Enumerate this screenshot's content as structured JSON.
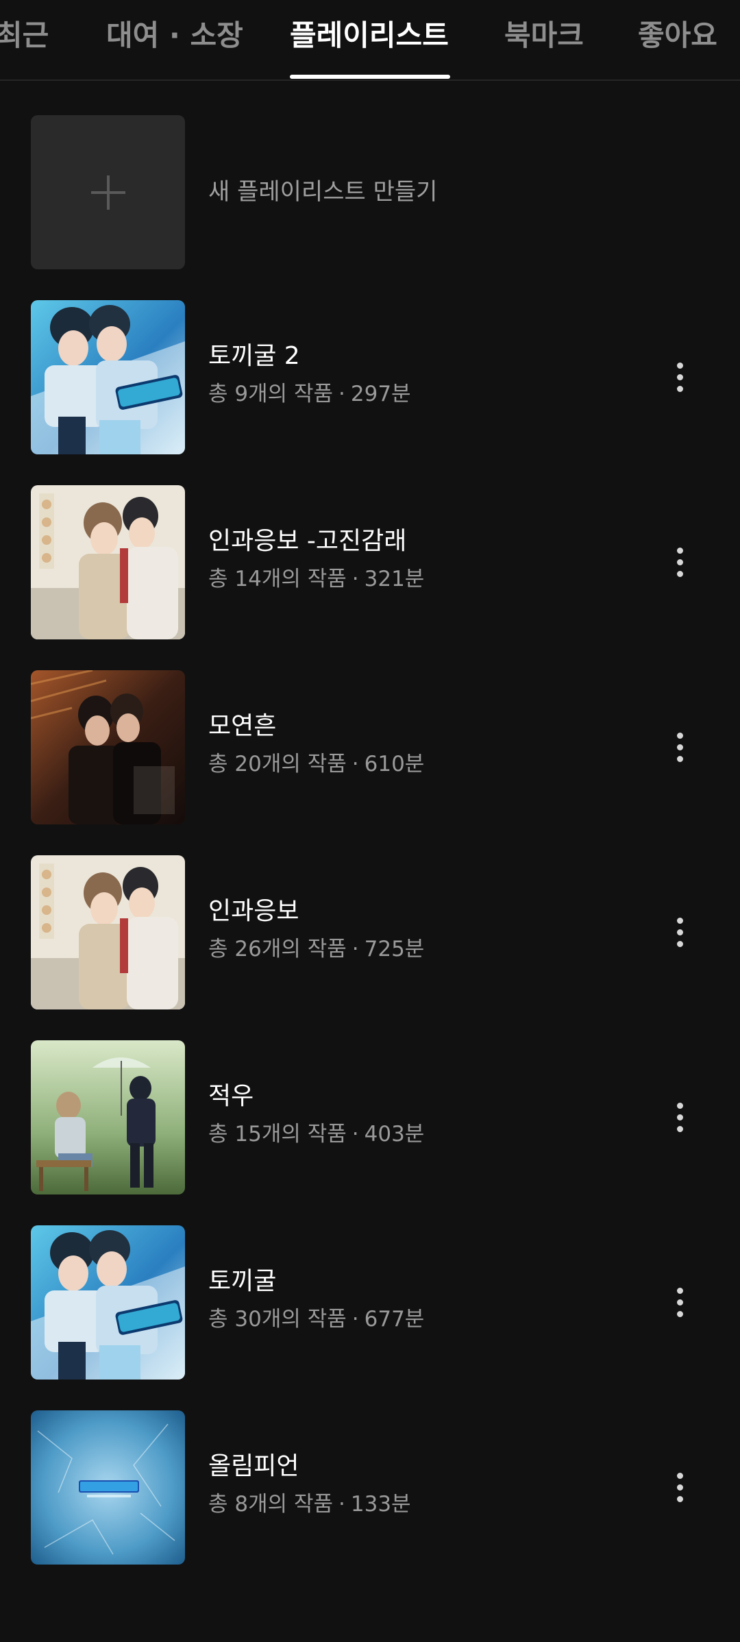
{
  "tabs": [
    {
      "label": "최근",
      "active": false
    },
    {
      "label": "대여 · 소장",
      "active": false
    },
    {
      "label": "플레이리스트",
      "active": true
    },
    {
      "label": "북마크",
      "active": false
    },
    {
      "label": "좋아요",
      "active": false
    }
  ],
  "new_playlist": {
    "label": "새 플레이리스트 만들기",
    "icon": "plus-icon"
  },
  "playlists": [
    {
      "title": "토끼굴 2",
      "count_text": "총 9개의 작품",
      "duration_text": "297분",
      "cover": "blue-comic-cover"
    },
    {
      "title": "인과응보 -고진감래",
      "count_text": "총 14개의 작품",
      "duration_text": "321분",
      "cover": "beige-illustration-cover"
    },
    {
      "title": "모연흔",
      "count_text": "총 20개의 작품",
      "duration_text": "610분",
      "cover": "dark-brown-cover"
    },
    {
      "title": "인과응보",
      "count_text": "총 26개의 작품",
      "duration_text": "725분",
      "cover": "beige-illustration-cover"
    },
    {
      "title": "적우",
      "count_text": "총 15개의 작품",
      "duration_text": "403분",
      "cover": "green-rain-cover"
    },
    {
      "title": "토끼굴",
      "count_text": "총 30개의 작품",
      "duration_text": "677분",
      "cover": "blue-comic-cover"
    },
    {
      "title": "올림피언",
      "count_text": "총 8개의 작품",
      "duration_text": "133분",
      "cover": "ice-blue-cover"
    }
  ],
  "colors": {
    "background": "#111111",
    "text_primary": "#ffffff",
    "text_secondary": "#9a9a9a",
    "tab_inactive": "#8e8e8e"
  }
}
